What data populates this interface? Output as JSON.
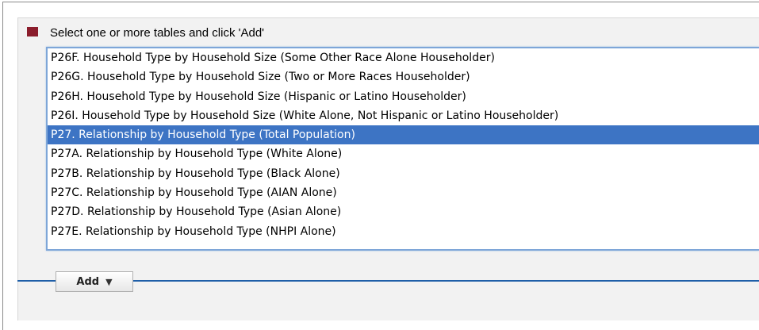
{
  "form": {
    "prompt": "Select one or more tables and click 'Add'",
    "accent_color": "#8b1d2c",
    "selection_color": "#3d74c4",
    "tables": [
      "P26F. Household Type by Household Size (Some Other Race Alone Householder)",
      "P26G. Household Type by Household Size (Two or More Races Householder)",
      "P26H. Household Type by Household Size (Hispanic or Latino Householder)",
      "P26I. Household Type by Household Size (White Alone, Not Hispanic or Latino Householder)",
      "P27. Relationship by Household Type (Total Population)",
      "P27A. Relationship by Household Type (White Alone)",
      "P27B. Relationship by Household Type (Black Alone)",
      "P27C. Relationship by Household Type (AIAN Alone)",
      "P27D. Relationship by Household Type (Asian Alone)",
      "P27E. Relationship by Household Type (NHPI Alone)"
    ],
    "selected_index": 4,
    "add_button": {
      "label": "Add",
      "icon": "triangle-down-icon"
    }
  }
}
